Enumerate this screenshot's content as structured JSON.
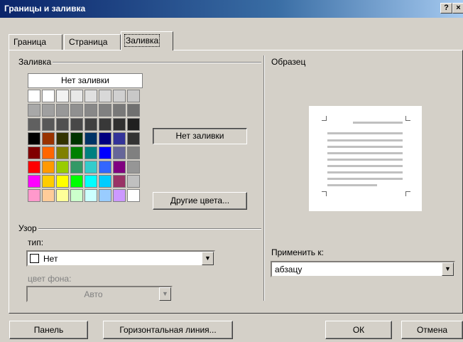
{
  "window": {
    "title": "Границы и заливка",
    "help_label": "?",
    "close_label": "×"
  },
  "tabs": [
    {
      "label": "Граница",
      "active": false
    },
    {
      "label": "Страница",
      "active": false
    },
    {
      "label": "Заливка",
      "active": true
    }
  ],
  "fill": {
    "group_label": "Заливка",
    "no_fill_label": "Нет заливки",
    "selected_label": "Нет заливки",
    "more_colors_label": "Другие цвета...",
    "palette": [
      [
        "#ffffff",
        "#ffffff",
        "#f2f2f2",
        "#e8e8e8",
        "#e0e0e0",
        "#d8d8d8",
        "#d0d0d0",
        "#c8c8c8"
      ],
      [
        "#a8a8a8",
        "#a0a0a0",
        "#989898",
        "#909090",
        "#888888",
        "#808080",
        "#787878",
        "#707070"
      ],
      [
        "#606060",
        "#585858",
        "#505050",
        "#484848",
        "#404040",
        "#383838",
        "#303030",
        "#202020"
      ],
      [
        "#000000",
        "#993300",
        "#333300",
        "#003300",
        "#003366",
        "#000080",
        "#333399",
        "#333333"
      ],
      [
        "#800000",
        "#ff6600",
        "#808000",
        "#008000",
        "#008080",
        "#0000ff",
        "#666699",
        "#808080"
      ],
      [
        "#ff0000",
        "#ff9900",
        "#99cc00",
        "#339966",
        "#33cccc",
        "#3366ff",
        "#800080",
        "#969696"
      ],
      [
        "#ff00ff",
        "#ffcc00",
        "#ffff00",
        "#00ff00",
        "#00ffff",
        "#00ccff",
        "#993366",
        "#c0c0c0"
      ],
      [
        "#ff99cc",
        "#ffcc99",
        "#ffff99",
        "#ccffcc",
        "#ccffff",
        "#99ccff",
        "#cc99ff",
        "#ffffff"
      ]
    ]
  },
  "pattern": {
    "group_label": "Узор",
    "type_label": "тип:",
    "type_value": "Нет",
    "bgcolor_label": "цвет фона:",
    "bgcolor_value": "Авто"
  },
  "preview": {
    "group_label": "Образец"
  },
  "apply": {
    "label": "Применить к:",
    "value": "абзацу"
  },
  "buttons": {
    "panel": "Панель",
    "hline": "Горизонтальная линия...",
    "ok": "ОК",
    "cancel": "Отмена"
  }
}
